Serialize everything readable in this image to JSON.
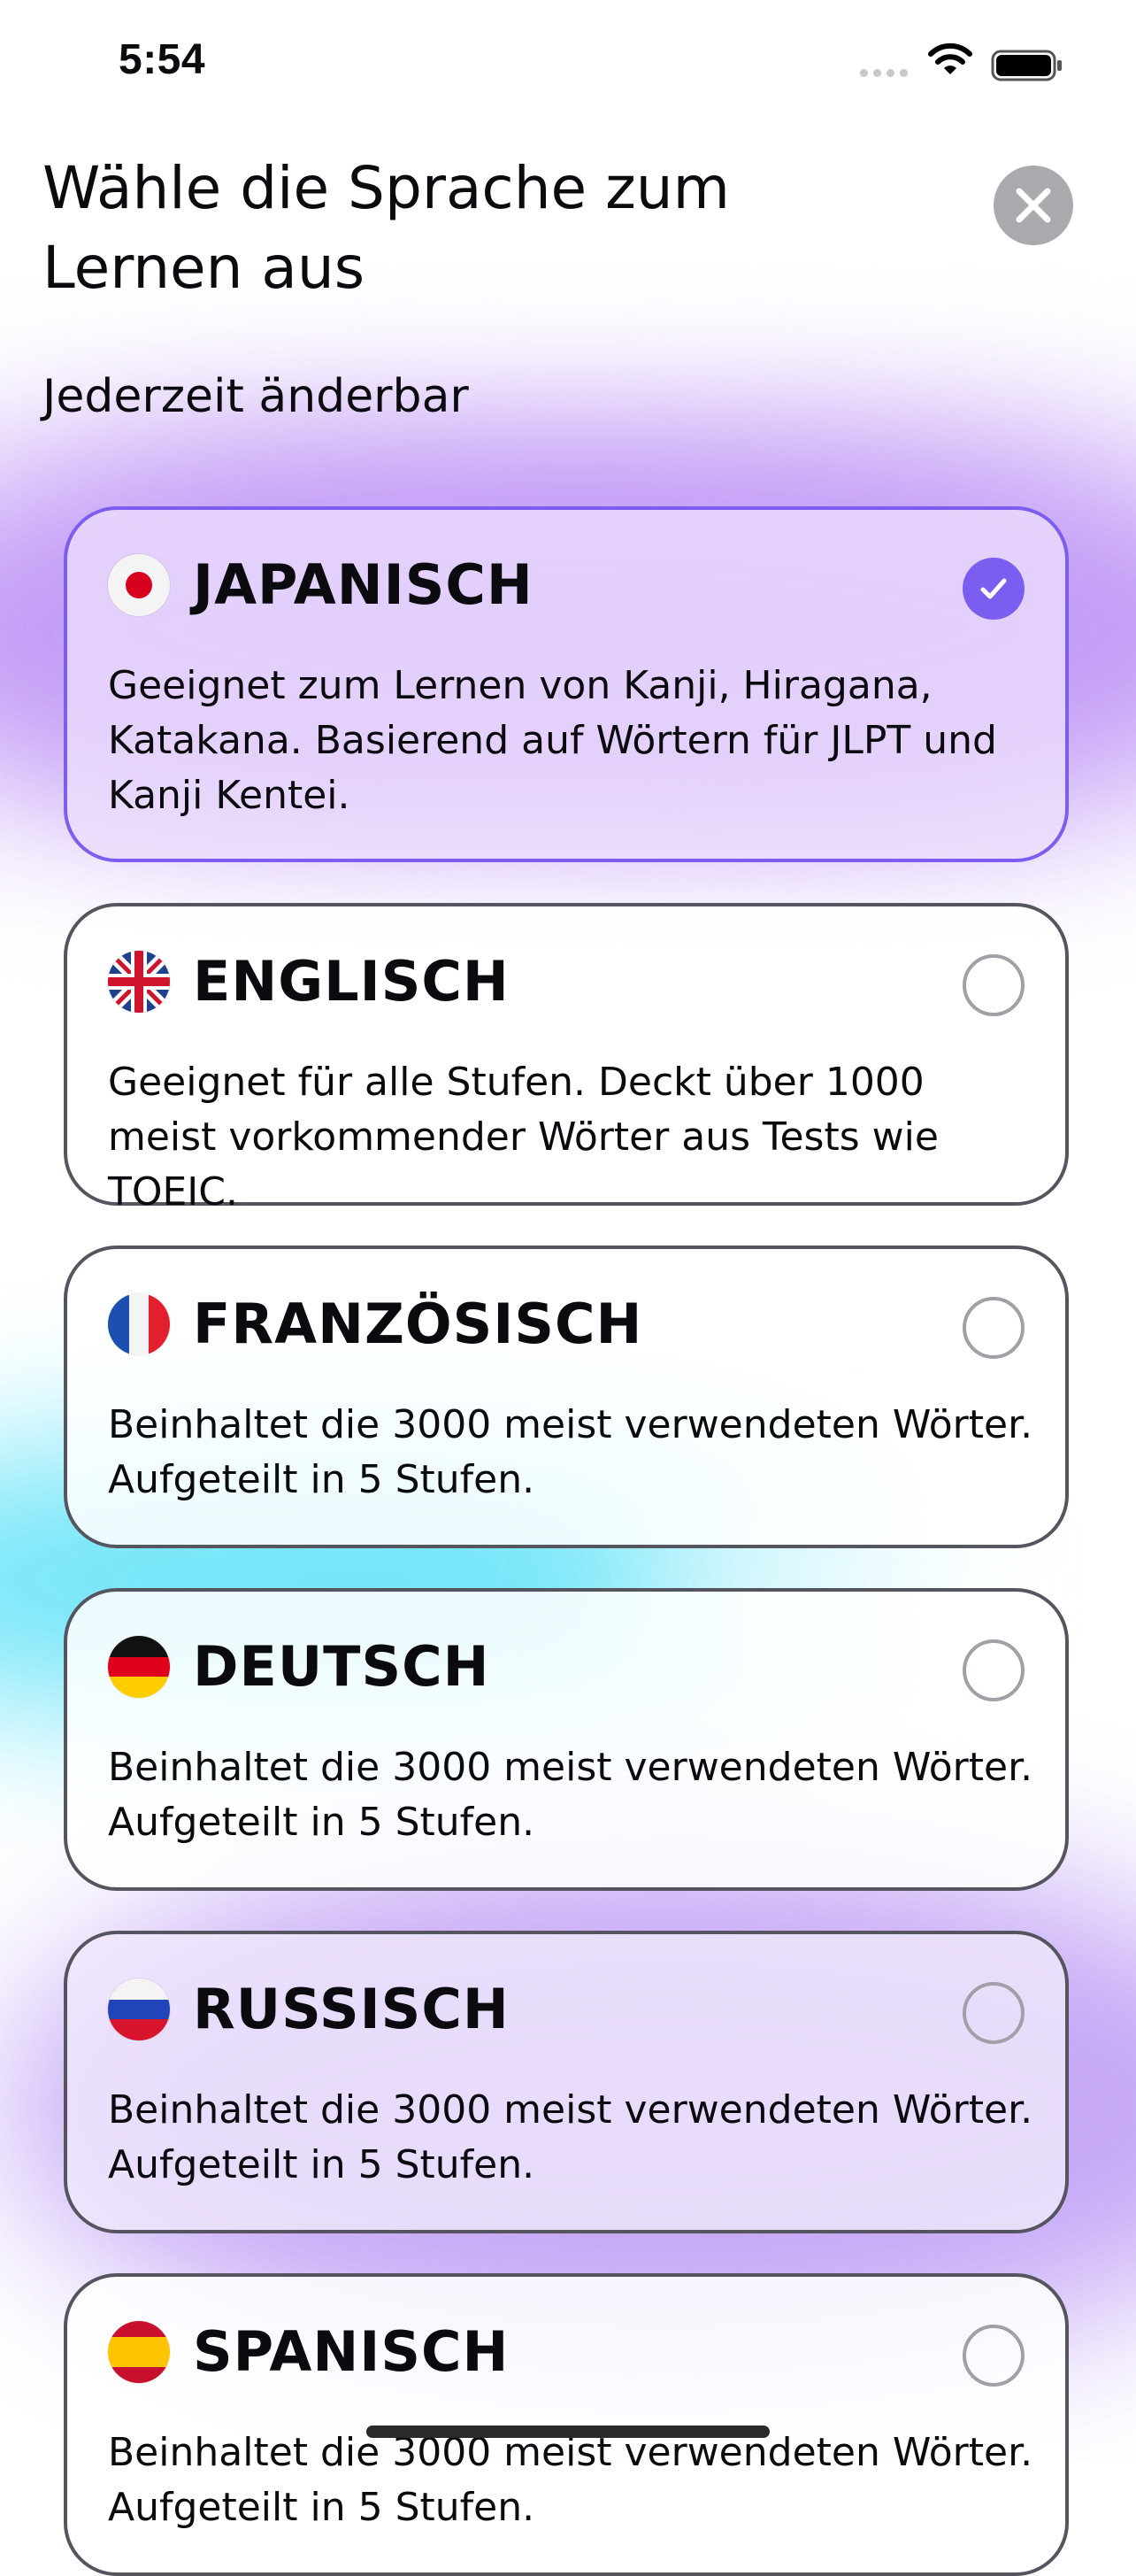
{
  "status_bar": {
    "time": "5:54",
    "icons": [
      "cellular-dots-icon",
      "wifi-icon",
      "battery-icon"
    ]
  },
  "header": {
    "title": "Wähle die Sprache zum Lernen aus",
    "subtitle": "Jederzeit änderbar",
    "close_icon": "close-icon"
  },
  "languages": [
    {
      "name": "JAPANISCH",
      "flag": "japan-flag-icon",
      "description": "Geeignet zum Lernen von Kanji, Hiragana, Katakana. Basierend auf Wörtern für JLPT und Kanji Kentei.",
      "selected": true
    },
    {
      "name": "ENGLISCH",
      "flag": "uk-flag-icon",
      "description": "Geeignet für alle Stufen. Deckt über 1000 meist vorkommender Wörter aus Tests wie TOEIC.",
      "selected": false
    },
    {
      "name": "FRANZÖSISCH",
      "flag": "france-flag-icon",
      "description": "Beinhaltet die 3000 meist verwendeten Wörter. Aufgeteilt in 5 Stufen.",
      "selected": false
    },
    {
      "name": "DEUTSCH",
      "flag": "germany-flag-icon",
      "description": "Beinhaltet die 3000 meist verwendeten Wörter. Aufgeteilt in 5 Stufen.",
      "selected": false
    },
    {
      "name": "RUSSISCH",
      "flag": "russia-flag-icon",
      "description": "Beinhaltet die 3000 meist verwendeten Wörter. Aufgeteilt in 5 Stufen.",
      "selected": false
    },
    {
      "name": "SPANISCH",
      "flag": "spain-flag-icon",
      "description": "Beinhaltet die 3000 meist verwendeten Wörter. Aufgeteilt in 5 Stufen.",
      "selected": false
    }
  ],
  "colors": {
    "accent": "#7b5ef0",
    "card_border": "#555560",
    "radio_border": "#a0a0a6",
    "close_button": "#8e8e93"
  }
}
